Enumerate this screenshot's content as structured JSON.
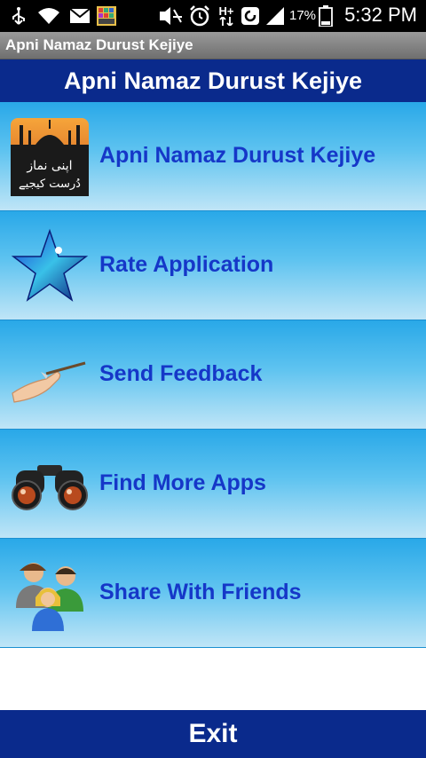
{
  "status_bar": {
    "battery_percent": "17%",
    "time": "5:32 PM",
    "network_label": "H+",
    "icons": [
      "usb-icon",
      "wifi-icon",
      "email-icon",
      "game-app-icon",
      "mute-icon",
      "alarm-icon",
      "data-arrows-icon",
      "sync-icon",
      "signal-icon",
      "battery-icon"
    ]
  },
  "title_bar": {
    "title": "Apni Namaz Durust Kejiye"
  },
  "header": {
    "title": "Apni Namaz Durust Kejiye"
  },
  "menu": {
    "items": [
      {
        "label": "Apni Namaz Durust Kejiye",
        "icon": "mosque-icon",
        "icon_text_line1": "اپنی نماز",
        "icon_text_line2": "دُرست کیجیے"
      },
      {
        "label": "Rate Application",
        "icon": "star-icon"
      },
      {
        "label": "Send Feedback",
        "icon": "pen-hand-icon"
      },
      {
        "label": "Find More Apps",
        "icon": "binoculars-icon"
      },
      {
        "label": "Share With Friends",
        "icon": "users-icon"
      }
    ]
  },
  "exit": {
    "label": "Exit"
  },
  "colors": {
    "header_bg": "#0a2a8c",
    "item_gradient_top": "#29a8e8",
    "item_gradient_bottom": "#bfe5f7",
    "label_color": "#1537c8"
  }
}
